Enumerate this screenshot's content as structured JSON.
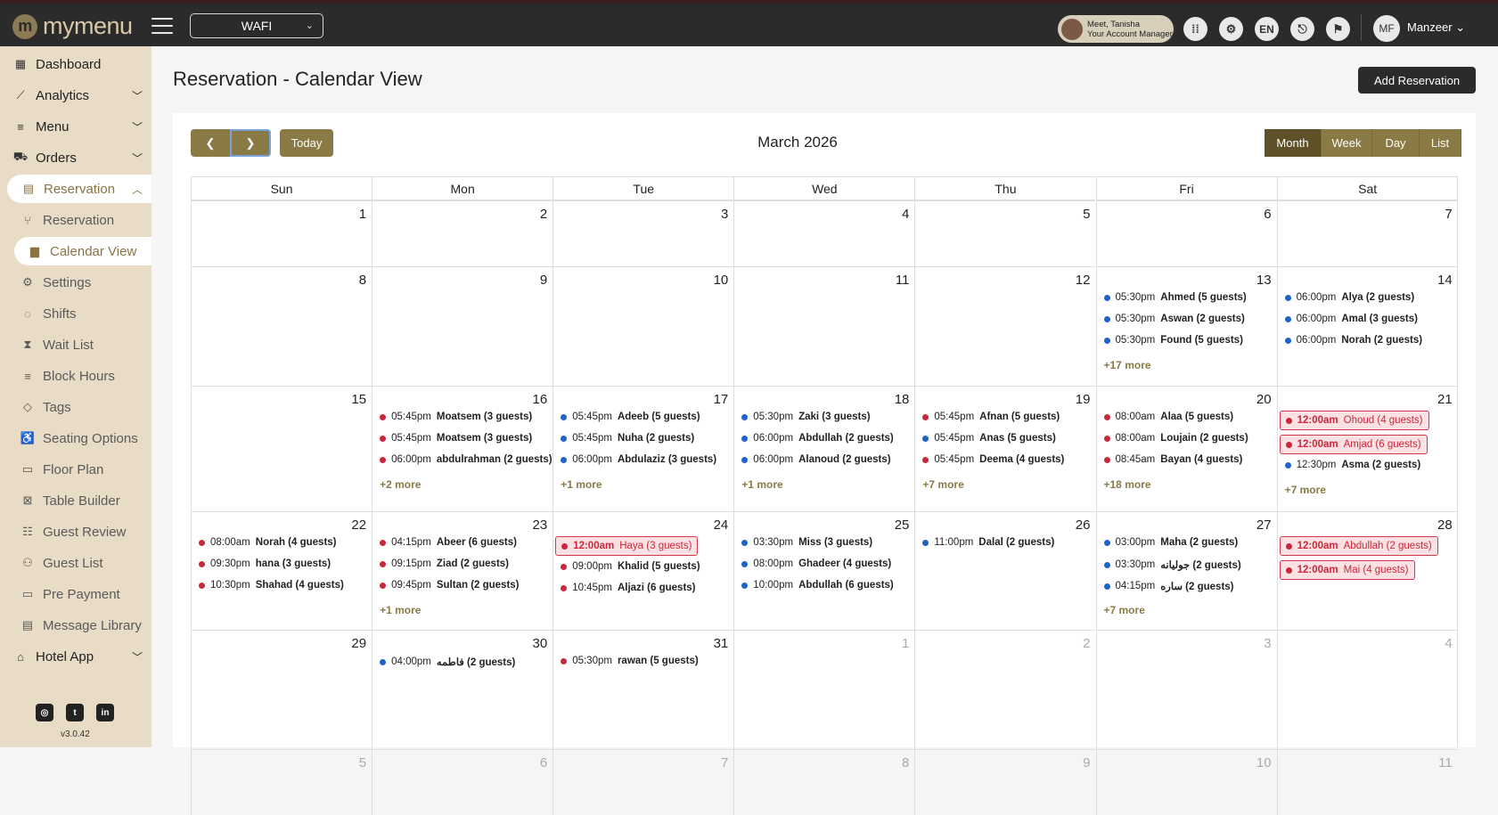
{
  "topbar": {
    "logo_text": "mymenu",
    "outlet": "WAFI",
    "manager_line1": "Meet, Tanisha",
    "manager_line2": "Your Account Manager",
    "language": "EN",
    "user_initials": "MF",
    "user_name": "Manzeer"
  },
  "sidebar": {
    "items": [
      {
        "label": "Dashboard",
        "icon": "dashboard-icon"
      },
      {
        "label": "Analytics",
        "icon": "analytics-icon"
      },
      {
        "label": "Menu",
        "icon": "menu-icon"
      },
      {
        "label": "Orders",
        "icon": "cart-icon"
      },
      {
        "label": "Reservation",
        "icon": "reservation-icon"
      },
      {
        "label": "Reservation",
        "icon": "cutlery-icon"
      },
      {
        "label": "Calendar View",
        "icon": "calendar-icon"
      },
      {
        "label": "Settings",
        "icon": "gear-icon"
      },
      {
        "label": "Shifts",
        "icon": "shifts-icon"
      },
      {
        "label": "Wait List",
        "icon": "hourglass-icon"
      },
      {
        "label": "Block Hours",
        "icon": "list-icon"
      },
      {
        "label": "Tags",
        "icon": "tag-icon"
      },
      {
        "label": "Seating Options",
        "icon": "wheelchair-icon"
      },
      {
        "label": "Floor Plan",
        "icon": "floor-plan-icon"
      },
      {
        "label": "Table Builder",
        "icon": "table-builder-icon"
      },
      {
        "label": "Guest Review",
        "icon": "guest-review-icon"
      },
      {
        "label": "Guest List",
        "icon": "guest-list-icon"
      },
      {
        "label": "Pre Payment",
        "icon": "payment-icon"
      },
      {
        "label": "Message Library",
        "icon": "message-icon"
      },
      {
        "label": "Hotel App",
        "icon": "hotel-icon"
      }
    ],
    "version": "v3.0.42"
  },
  "page": {
    "title": "Reservation - Calendar View",
    "add_button": "Add Reservation"
  },
  "calendar": {
    "title": "March 2026",
    "today_label": "Today",
    "views": [
      "Month",
      "Week",
      "Day",
      "List"
    ],
    "active_view": "Month",
    "weekdays": [
      "Sun",
      "Mon",
      "Tue",
      "Wed",
      "Thu",
      "Fri",
      "Sat"
    ],
    "weeks": [
      [
        {
          "d": "1"
        },
        {
          "d": "2"
        },
        {
          "d": "3"
        },
        {
          "d": "4"
        },
        {
          "d": "5"
        },
        {
          "d": "6"
        },
        {
          "d": "7"
        }
      ],
      [
        {
          "d": "8"
        },
        {
          "d": "9"
        },
        {
          "d": "10"
        },
        {
          "d": "11"
        },
        {
          "d": "12"
        },
        {
          "d": "13",
          "events": [
            {
              "t": "05:30pm",
              "n": "Ahmed (5 guests)",
              "c": "blue"
            },
            {
              "t": "05:30pm",
              "n": "Aswan (2 guests)",
              "c": "blue"
            },
            {
              "t": "05:30pm",
              "n": "Found (5 guests)",
              "c": "blue"
            }
          ],
          "more": "+17 more"
        },
        {
          "d": "14",
          "events": [
            {
              "t": "06:00pm",
              "n": "Alya (2 guests)",
              "c": "blue"
            },
            {
              "t": "06:00pm",
              "n": "Amal (3 guests)",
              "c": "blue"
            },
            {
              "t": "06:00pm",
              "n": "Norah (2 guests)",
              "c": "blue"
            }
          ]
        }
      ],
      [
        {
          "d": "15"
        },
        {
          "d": "16",
          "events": [
            {
              "t": "05:45pm",
              "n": "Moatsem (3 guests)",
              "c": "red"
            },
            {
              "t": "05:45pm",
              "n": "Moatsem (3 guests)",
              "c": "red"
            },
            {
              "t": "06:00pm",
              "n": "abdulrahman (2 guests)",
              "c": "red"
            }
          ],
          "more": "+2 more"
        },
        {
          "d": "17",
          "events": [
            {
              "t": "05:45pm",
              "n": "Adeeb (5 guests)",
              "c": "blue"
            },
            {
              "t": "05:45pm",
              "n": "Nuha (2 guests)",
              "c": "blue"
            },
            {
              "t": "06:00pm",
              "n": "Abdulaziz (3 guests)",
              "c": "blue"
            }
          ],
          "more": "+1 more"
        },
        {
          "d": "18",
          "events": [
            {
              "t": "05:30pm",
              "n": "Zaki (3 guests)",
              "c": "blue"
            },
            {
              "t": "06:00pm",
              "n": "Abdullah (2 guests)",
              "c": "blue"
            },
            {
              "t": "06:00pm",
              "n": "Alanoud (2 guests)",
              "c": "blue"
            }
          ],
          "more": "+1 more"
        },
        {
          "d": "19",
          "events": [
            {
              "t": "05:45pm",
              "n": "Afnan (5 guests)",
              "c": "red"
            },
            {
              "t": "05:45pm",
              "n": "Anas (5 guests)",
              "c": "blue"
            },
            {
              "t": "05:45pm",
              "n": "Deema (4 guests)",
              "c": "red"
            }
          ],
          "more": "+7 more"
        },
        {
          "d": "20",
          "events": [
            {
              "t": "08:00am",
              "n": "Alaa (5 guests)",
              "c": "red"
            },
            {
              "t": "08:00am",
              "n": "Loujain (2 guests)",
              "c": "red"
            },
            {
              "t": "08:45am",
              "n": "Bayan (4 guests)",
              "c": "red"
            }
          ],
          "more": "+18 more"
        },
        {
          "d": "21",
          "events": [
            {
              "t": "12:00am",
              "n": "Ohoud (4 guests)",
              "c": "red",
              "hl": true
            },
            {
              "t": "12:00am",
              "n": "Amjad (6 guests)",
              "c": "red",
              "hl": true
            },
            {
              "t": "12:30pm",
              "n": "Asma (2 guests)",
              "c": "blue"
            }
          ],
          "more": "+7 more"
        }
      ],
      [
        {
          "d": "22",
          "events": [
            {
              "t": "08:00am",
              "n": "Norah (4 guests)",
              "c": "red"
            },
            {
              "t": "09:30pm",
              "n": "hana (3 guests)",
              "c": "red"
            },
            {
              "t": "10:30pm",
              "n": "Shahad (4 guests)",
              "c": "red"
            }
          ]
        },
        {
          "d": "23",
          "events": [
            {
              "t": "04:15pm",
              "n": "Abeer (6 guests)",
              "c": "red"
            },
            {
              "t": "09:15pm",
              "n": "Ziad (2 guests)",
              "c": "red"
            },
            {
              "t": "09:45pm",
              "n": "Sultan (2 guests)",
              "c": "red"
            }
          ],
          "more": "+1 more"
        },
        {
          "d": "24",
          "events": [
            {
              "t": "12:00am",
              "n": "Haya (3 guests)",
              "c": "red",
              "hl": true
            },
            {
              "t": "09:00pm",
              "n": "Khalid (5 guests)",
              "c": "red"
            },
            {
              "t": "10:45pm",
              "n": "Aljazi (6 guests)",
              "c": "red"
            }
          ]
        },
        {
          "d": "25",
          "events": [
            {
              "t": "03:30pm",
              "n": "Miss (3 guests)",
              "c": "blue"
            },
            {
              "t": "08:00pm",
              "n": "Ghadeer (4 guests)",
              "c": "blue"
            },
            {
              "t": "10:00pm",
              "n": "Abdullah (6 guests)",
              "c": "blue"
            }
          ]
        },
        {
          "d": "26",
          "events": [
            {
              "t": "11:00pm",
              "n": "Dalal (2 guests)",
              "c": "blue"
            }
          ]
        },
        {
          "d": "27",
          "events": [
            {
              "t": "03:00pm",
              "n": "Maha (2 guests)",
              "c": "blue"
            },
            {
              "t": "03:30pm",
              "n": "جوليانه (2 guests)",
              "c": "blue"
            },
            {
              "t": "04:15pm",
              "n": "ساره (2 guests)",
              "c": "blue"
            }
          ],
          "more": "+7 more"
        },
        {
          "d": "28",
          "events": [
            {
              "t": "12:00am",
              "n": "Abdullah (2 guests)",
              "c": "red",
              "hl": true
            },
            {
              "t": "12:00am",
              "n": "Mai (4 guests)",
              "c": "red",
              "hl": true
            }
          ]
        }
      ],
      [
        {
          "d": "29"
        },
        {
          "d": "30",
          "events": [
            {
              "t": "04:00pm",
              "n": "فاطمه (2 guests)",
              "c": "blue"
            }
          ]
        },
        {
          "d": "31",
          "events": [
            {
              "t": "05:30pm",
              "n": "rawan (5 guests)",
              "c": "red"
            }
          ]
        },
        {
          "d": "1",
          "other": true
        },
        {
          "d": "2",
          "other": true
        },
        {
          "d": "3",
          "other": true
        },
        {
          "d": "4",
          "other": true
        }
      ],
      [
        {
          "d": "5",
          "other": true
        },
        {
          "d": "6",
          "other": true
        },
        {
          "d": "7",
          "other": true
        },
        {
          "d": "8",
          "other": true
        },
        {
          "d": "9",
          "other": true
        },
        {
          "d": "10",
          "other": true
        },
        {
          "d": "11",
          "other": true
        }
      ]
    ]
  },
  "colors": {
    "accent": "#8a7a45",
    "red_dot": "#c8283a",
    "blue_dot": "#1f63c9",
    "sidebar": "#e8dcc6"
  }
}
